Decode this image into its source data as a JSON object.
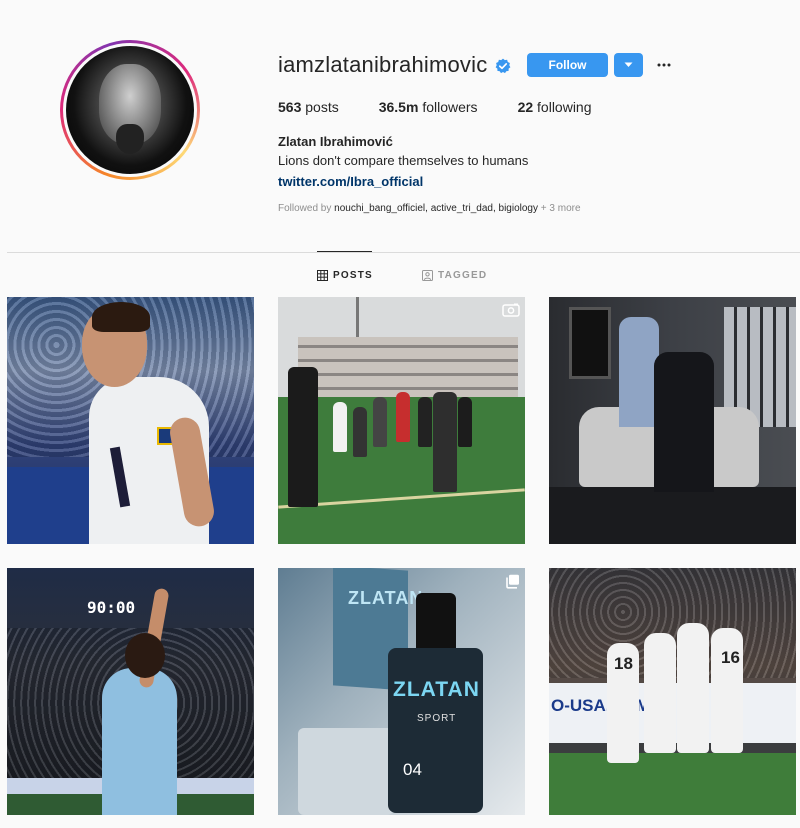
{
  "profile": {
    "username": "iamzlatanibrahimovic",
    "follow_label": "Follow",
    "stats": {
      "posts_count": "563",
      "posts_label": "posts",
      "followers_count": "36.5m",
      "followers_label": "followers",
      "following_count": "22",
      "following_label": "following"
    },
    "full_name": "Zlatan Ibrahimović",
    "bio": "Lions don't compare themselves to humans",
    "link": "twitter.com/Ibra_official",
    "followed_by_prefix": "Followed by",
    "followed_by_names": "nouchi_bang_officiel, active_tri_dad, bigiology",
    "followed_by_more": "+ 3 more"
  },
  "tabs": [
    {
      "label": "POSTS",
      "active": true,
      "icon": "grid-icon"
    },
    {
      "label": "TAGGED",
      "active": false,
      "icon": "tag-icon"
    }
  ],
  "posts": [
    {
      "id": "post-1",
      "type": "image"
    },
    {
      "id": "post-2",
      "type": "video",
      "icon": "video-icon"
    },
    {
      "id": "post-3",
      "type": "image"
    },
    {
      "id": "post-4",
      "type": "image",
      "scoreboard": "90:00"
    },
    {
      "id": "post-5",
      "type": "carousel",
      "icon": "carousel-icon",
      "brand": "ZLATAN",
      "brand_sub": "SPORT",
      "number": "04",
      "box_text": "ZLATAN"
    },
    {
      "id": "post-6",
      "type": "image",
      "board_text": "O-USA.COM",
      "numbers": [
        "18",
        "16"
      ]
    }
  ],
  "colors": {
    "accent": "#3897f0",
    "link": "#003569",
    "muted": "#8e8e8e",
    "text": "#262626",
    "background": "#fafafa"
  }
}
